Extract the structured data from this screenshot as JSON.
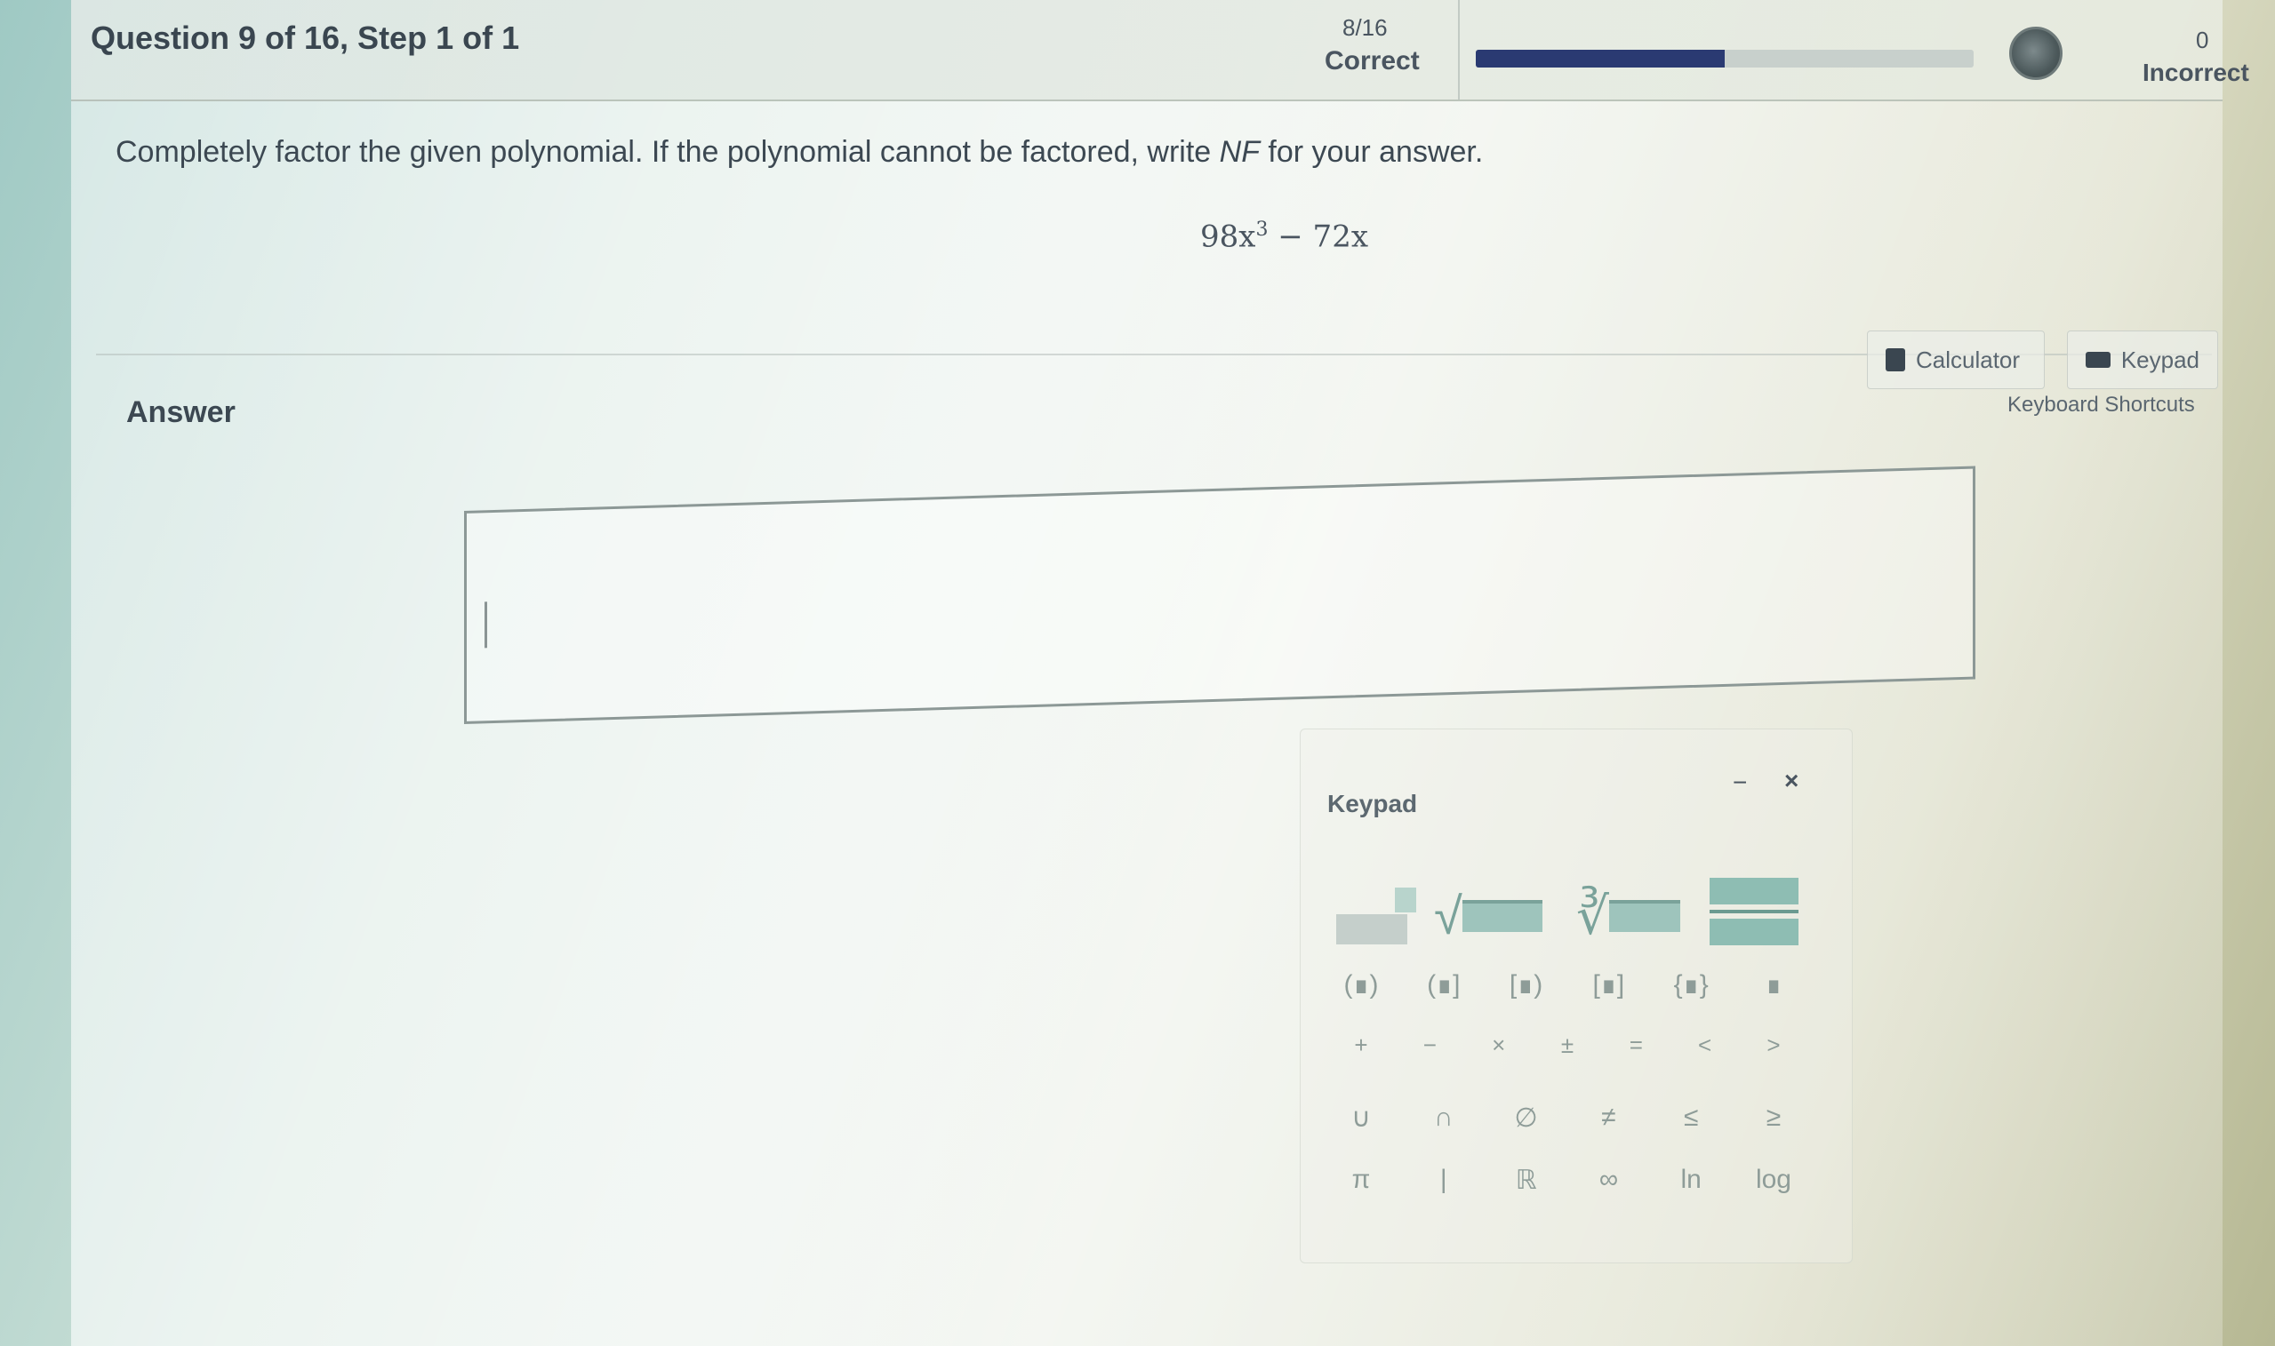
{
  "header": {
    "question_title": "Question 9 of 16, Step 1 of 1",
    "progress_count": "8/16",
    "correct_label": "Correct",
    "progress_fraction": 0.5,
    "incorrect_count": "0",
    "incorrect_label": "Incorrect"
  },
  "question": {
    "instruction_before": "Completely factor the given polynomial. If the polynomial cannot be factored, write ",
    "instruction_em": "NF",
    "instruction_after": " for your answer.",
    "poly_term1": "98x",
    "poly_exp": "3",
    "poly_rest": " − 72x"
  },
  "answer": {
    "label": "Answer",
    "value": ""
  },
  "tools": {
    "calculator_label": "Calculator",
    "keypad_label": "Keypad",
    "shortcuts_label": "Keyboard Shortcuts"
  },
  "keypad": {
    "title": "Keypad",
    "minimize": "−",
    "close": "×",
    "brackets": [
      "(∎)",
      "(∎]",
      "[∎)",
      "[∎]",
      "{∎}",
      "∎"
    ],
    "ops": [
      "+",
      "−",
      "×",
      "±",
      "=",
      "<",
      ">"
    ],
    "sets": [
      "∪",
      "∩",
      "∅",
      "≠",
      "≤",
      "≥"
    ],
    "funcs": [
      "π",
      "|",
      "ℝ",
      "∞",
      "ln",
      "log"
    ]
  },
  "colors": {
    "progress_fill": "#2a3a72",
    "text_dark": "#3c4852"
  }
}
